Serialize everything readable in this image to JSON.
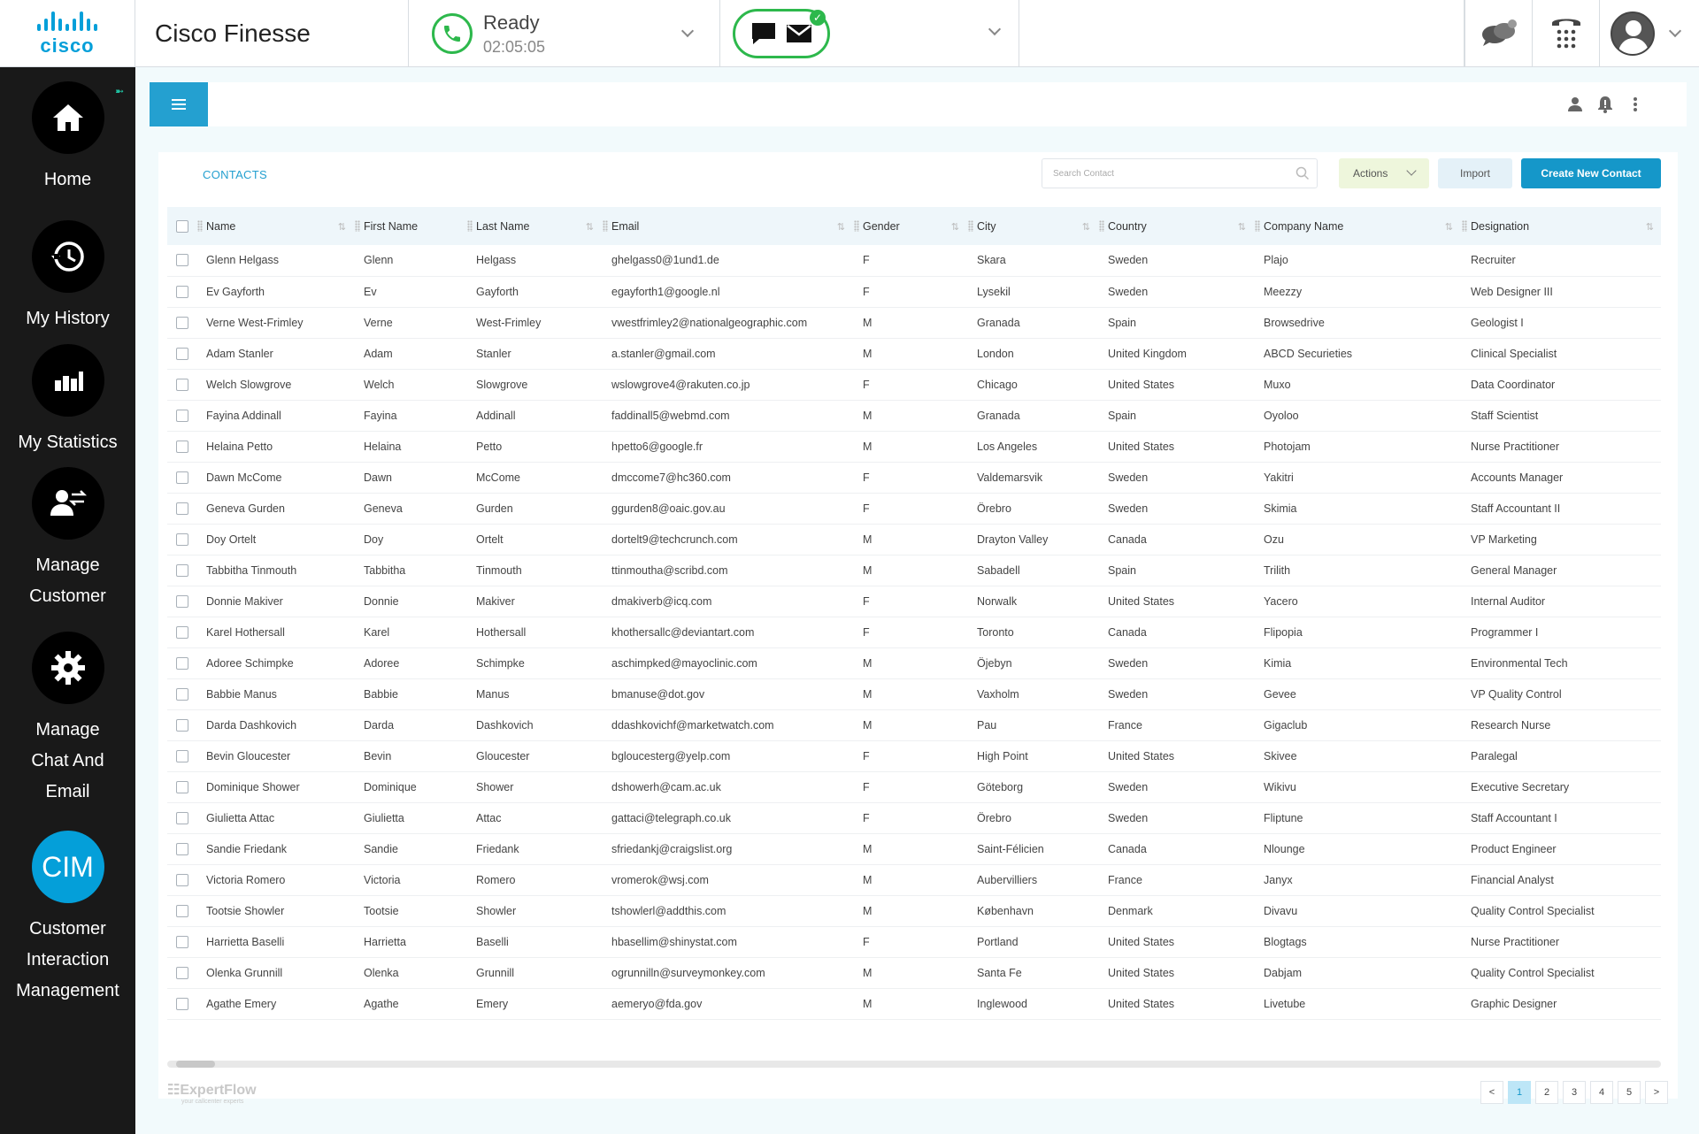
{
  "app": {
    "logo_text": "cisco",
    "name": "Cisco Finesse"
  },
  "status": {
    "label": "Ready",
    "timer": "02:05:05"
  },
  "sidebar": {
    "items": [
      {
        "label": "Home",
        "icon": "home-icon"
      },
      {
        "label": "My History",
        "icon": "history-icon"
      },
      {
        "label": "My Statistics",
        "icon": "statistics-icon"
      },
      {
        "label": "Manage Customer",
        "icon": "manage-customer-icon"
      },
      {
        "label": "Manage Chat And Email",
        "icon": "gear-icon"
      },
      {
        "label": "Customer Interaction Management",
        "icon": "CIM"
      }
    ]
  },
  "panel": {
    "breadcrumb": "CONTACTS",
    "search_placeholder": "Search Contact",
    "actions_label": "Actions",
    "import_label": "Import",
    "create_label": "Create New Contact"
  },
  "table": {
    "columns": [
      "Name",
      "First Name",
      "Last Name",
      "Email",
      "Gender",
      "City",
      "Country",
      "Company Name",
      "Designation"
    ],
    "rows": [
      [
        "Glenn Helgass",
        "Glenn",
        "Helgass",
        "ghelgass0@1und1.de",
        "F",
        "Skara",
        "Sweden",
        "Plajo",
        "Recruiter"
      ],
      [
        "Ev Gayforth",
        "Ev",
        "Gayforth",
        "egayforth1@google.nl",
        "F",
        "Lysekil",
        "Sweden",
        "Meezzy",
        "Web Designer III"
      ],
      [
        "Verne West-Frimley",
        "Verne",
        "West-Frimley",
        "vwestfrimley2@nationalgeographic.com",
        "M",
        "Granada",
        "Spain",
        "Browsedrive",
        "Geologist I"
      ],
      [
        "Adam Stanler",
        "Adam",
        "Stanler",
        "a.stanler@gmail.com",
        "M",
        "London",
        "United Kingdom",
        "ABCD Securieties",
        "Clinical Specialist"
      ],
      [
        "Welch Slowgrove",
        "Welch",
        "Slowgrove",
        "wslowgrove4@rakuten.co.jp",
        "F",
        "Chicago",
        "United States",
        "Muxo",
        "Data Coordinator"
      ],
      [
        "Fayina Addinall",
        "Fayina",
        "Addinall",
        "faddinall5@webmd.com",
        "M",
        "Granada",
        "Spain",
        "Oyoloo",
        "Staff Scientist"
      ],
      [
        "Helaina Petto",
        "Helaina",
        "Petto",
        "hpetto6@google.fr",
        "M",
        "Los Angeles",
        "United States",
        "Photojam",
        "Nurse Practitioner"
      ],
      [
        "Dawn McCome",
        "Dawn",
        "McCome",
        "dmccome7@hc360.com",
        "F",
        "Valdemarsvik",
        "Sweden",
        "Yakitri",
        "Accounts Manager"
      ],
      [
        "Geneva Gurden",
        "Geneva",
        "Gurden",
        "ggurden8@oaic.gov.au",
        "F",
        "Örebro",
        "Sweden",
        "Skimia",
        "Staff Accountant II"
      ],
      [
        "Doy Ortelt",
        "Doy",
        "Ortelt",
        "dortelt9@techcrunch.com",
        "M",
        "Drayton Valley",
        "Canada",
        "Ozu",
        "VP Marketing"
      ],
      [
        "Tabbitha Tinmouth",
        "Tabbitha",
        "Tinmouth",
        "ttinmoutha@scribd.com",
        "M",
        "Sabadell",
        "Spain",
        "Trilith",
        "General Manager"
      ],
      [
        "Donnie Makiver",
        "Donnie",
        "Makiver",
        "dmakiverb@icq.com",
        "F",
        "Norwalk",
        "United States",
        "Yacero",
        "Internal Auditor"
      ],
      [
        "Karel Hothersall",
        "Karel",
        "Hothersall",
        "khothersallc@deviantart.com",
        "F",
        "Toronto",
        "Canada",
        "Flipopia",
        "Programmer I"
      ],
      [
        "Adoree Schimpke",
        "Adoree",
        "Schimpke",
        "aschimpked@mayoclinic.com",
        "M",
        "Öjebyn",
        "Sweden",
        "Kimia",
        "Environmental Tech"
      ],
      [
        "Babbie Manus",
        "Babbie",
        "Manus",
        "bmanuse@dot.gov",
        "M",
        "Vaxholm",
        "Sweden",
        "Gevee",
        "VP Quality Control"
      ],
      [
        "Darda Dashkovich",
        "Darda",
        "Dashkovich",
        "ddashkovichf@marketwatch.com",
        "M",
        "Pau",
        "France",
        "Gigaclub",
        "Research Nurse"
      ],
      [
        "Bevin Gloucester",
        "Bevin",
        "Gloucester",
        "bgloucesterg@yelp.com",
        "F",
        "High Point",
        "United States",
        "Skivee",
        "Paralegal"
      ],
      [
        "Dominique Shower",
        "Dominique",
        "Shower",
        "dshowerh@cam.ac.uk",
        "F",
        "Göteborg",
        "Sweden",
        "Wikivu",
        "Executive Secretary"
      ],
      [
        "Giulietta Attac",
        "Giulietta",
        "Attac",
        "gattaci@telegraph.co.uk",
        "F",
        "Örebro",
        "Sweden",
        "Fliptune",
        "Staff Accountant I"
      ],
      [
        "Sandie Friedank",
        "Sandie",
        "Friedank",
        "sfriedankj@craigslist.org",
        "M",
        "Saint-Félicien",
        "Canada",
        "Nlounge",
        "Product Engineer"
      ],
      [
        "Victoria Romero",
        "Victoria",
        "Romero",
        "vromerok@wsj.com",
        "M",
        "Aubervilliers",
        "France",
        "Janyx",
        "Financial Analyst"
      ],
      [
        "Tootsie Showler",
        "Tootsie",
        "Showler",
        "tshowlerl@addthis.com",
        "M",
        "København",
        "Denmark",
        "Divavu",
        "Quality Control Specialist"
      ],
      [
        "Harrietta Baselli",
        "Harrietta",
        "Baselli",
        "hbasellim@shinystat.com",
        "F",
        "Portland",
        "United States",
        "Blogtags",
        "Nurse Practitioner"
      ],
      [
        "Olenka Grunnill",
        "Olenka",
        "Grunnill",
        "ogrunnilln@surveymonkey.com",
        "M",
        "Santa Fe",
        "United States",
        "Dabjam",
        "Quality Control Specialist"
      ],
      [
        "Agathe Emery",
        "Agathe",
        "Emery",
        "aemeryo@fda.gov",
        "M",
        "Inglewood",
        "United States",
        "Livetube",
        "Graphic Designer"
      ]
    ]
  },
  "footer": {
    "brand": "ExpertFlow",
    "tagline": "your callcenter experts"
  },
  "pagination": {
    "prev": "<",
    "next": ">",
    "pages": [
      "1",
      "2",
      "3",
      "4",
      "5"
    ],
    "current": "1"
  },
  "colors": {
    "accent": "#049fd9",
    "ready_green": "#2db84c",
    "sidebar_bg": "#191919"
  }
}
